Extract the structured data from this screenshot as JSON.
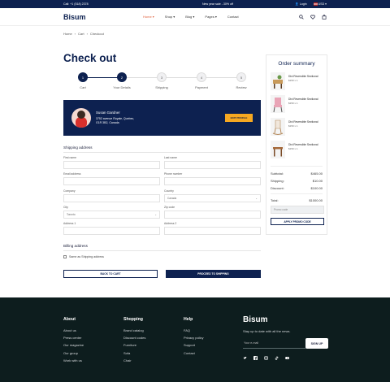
{
  "topbar": {
    "phone": "Call: +1 (518) 2378",
    "promo": "New year sale - 30% off",
    "login": "Login",
    "currency": "USD"
  },
  "nav": {
    "logo": "Bisum",
    "items": [
      "Home",
      "Shop",
      "Blog",
      "Pages",
      "Contact"
    ],
    "accent": "#e0623f"
  },
  "breadcrumb": [
    "Home",
    "Cart",
    "Checkout"
  ],
  "page_title": "Check out",
  "steps": [
    {
      "num": "1",
      "label": "Cart"
    },
    {
      "num": "2",
      "label": "Your Details"
    },
    {
      "num": "3",
      "label": "Shipping"
    },
    {
      "num": "4",
      "label": "Payment"
    },
    {
      "num": "5",
      "label": "Review"
    }
  ],
  "profile": {
    "name": "Susan Gardner",
    "address_line1": "3752 avenue Royale, Quebec,",
    "address_line2": "G1R 3B2, Canada",
    "edit_label": "EDIT PROFILE"
  },
  "shipping": {
    "title": "Shipping address",
    "first_name": "First name",
    "last_name": "Last name",
    "email": "Email address",
    "phone": "Phone number",
    "company": "Company",
    "country": "Country",
    "country_value": "Canada",
    "city": "City",
    "city_value": "Toronto",
    "zip": "Zip code",
    "address1": "Address 1",
    "address2": "Address 2"
  },
  "billing": {
    "title": "Billing address",
    "same_label": "Same as Shipping address"
  },
  "buttons": {
    "back": "BACK TO CART",
    "proceed": "PROCEED TO SHIPPING"
  },
  "summary": {
    "title": "Order summary",
    "items": [
      {
        "name": "Dixi Reversible Sectional",
        "price": "$150 x 1"
      },
      {
        "name": "Dixi Reversible Sectional",
        "price": "$150 x 1"
      },
      {
        "name": "Dixi Reversible Sectional",
        "price": "$150 x 1"
      },
      {
        "name": "Dixi Reversible Sectional",
        "price": "$150 x 1"
      }
    ],
    "subtotal_label": "Subtotal:",
    "subtotal": "$465.00",
    "shipping_label": "Shipping:",
    "shipping": "$10.00",
    "discount_label": "Discount:",
    "discount": "$100.00",
    "total_label": "Total:",
    "total": "$1000.00",
    "promo_placeholder": "Promo code",
    "apply_label": "APPLY PROMO CODE"
  },
  "footer": {
    "about": {
      "title": "About",
      "links": [
        "About us",
        "Press center",
        "Our magazine",
        "Our group",
        "Work with us"
      ]
    },
    "shopping": {
      "title": "Shopping",
      "links": [
        "Brand catalog",
        "Discount codes",
        "Furniture",
        "Sofa",
        "Chair"
      ]
    },
    "help": {
      "title": "Help",
      "links": [
        "FAQ",
        "Privacy policy",
        "Support",
        "Contact"
      ]
    },
    "brand": "Bisum",
    "tagline": "Stay up to date with all the news.",
    "email_placeholder": "Your e-mail",
    "signup": "SIGN UP",
    "social": [
      "twitter-icon",
      "facebook-icon",
      "instagram-icon",
      "tiktok-icon",
      "youtube-icon"
    ]
  },
  "colors": {
    "navy": "#0d2150",
    "orange": "#f6a821",
    "footer_bg": "#0d1d1e"
  }
}
